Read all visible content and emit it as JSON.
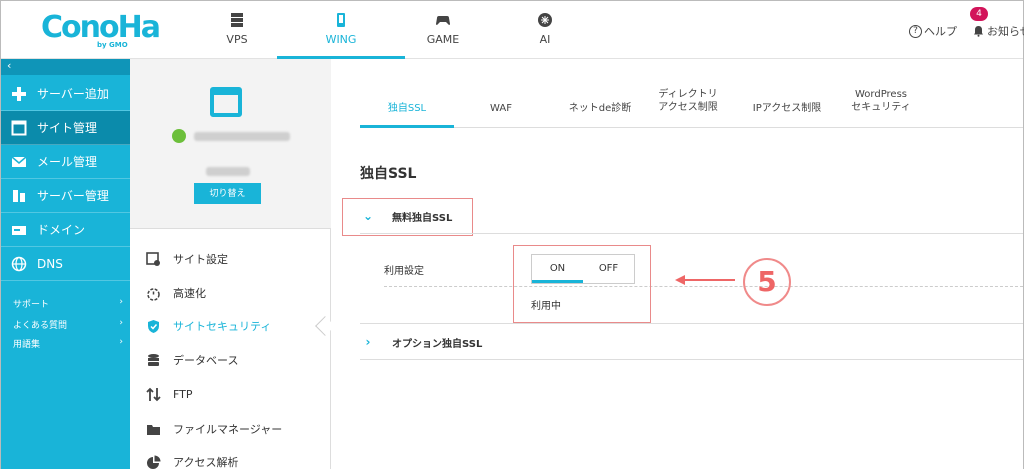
{
  "brand": {
    "name": "ConoHa",
    "sub": "by GMO"
  },
  "service_tabs": [
    {
      "label": "VPS",
      "icon": "server-icon",
      "active": false
    },
    {
      "label": "WING",
      "icon": "phone-icon",
      "active": true
    },
    {
      "label": "GAME",
      "icon": "gamepad-icon",
      "active": false
    },
    {
      "label": "AI",
      "icon": "ai-icon",
      "active": false
    }
  ],
  "header_right": {
    "help": "ヘルプ",
    "notice": "お知らせ",
    "notice_count": "4"
  },
  "sidebar": {
    "collapse": "‹",
    "items": [
      {
        "label": "サーバー追加",
        "icon": "plus-icon",
        "active": false
      },
      {
        "label": "サイト管理",
        "icon": "window-icon",
        "active": true
      },
      {
        "label": "メール管理",
        "icon": "mail-icon",
        "active": false
      },
      {
        "label": "サーバー管理",
        "icon": "server-manage-icon",
        "active": false
      },
      {
        "label": "ドメイン",
        "icon": "domain-icon",
        "active": false
      },
      {
        "label": "DNS",
        "icon": "globe-icon",
        "active": false
      }
    ],
    "sub_links": [
      {
        "label": "サポート",
        "arrow": "›"
      },
      {
        "label": "よくある質問",
        "arrow": "›"
      },
      {
        "label": "用語集",
        "arrow": "›"
      }
    ]
  },
  "server_panel": {
    "switch_label": "切り替え"
  },
  "site_menu": [
    {
      "label": "サイト設定",
      "icon": "site-settings-icon",
      "active": false
    },
    {
      "label": "高速化",
      "icon": "stopwatch-icon",
      "active": false
    },
    {
      "label": "サイトセキュリティ",
      "icon": "shield-icon",
      "active": true
    },
    {
      "label": "データベース",
      "icon": "database-icon",
      "active": false
    },
    {
      "label": "FTP",
      "icon": "transfer-icon",
      "active": false
    },
    {
      "label": "ファイルマネージャー",
      "icon": "folder-icon",
      "active": false
    },
    {
      "label": "アクセス解析",
      "icon": "pie-chart-icon",
      "active": false
    }
  ],
  "security_tabs": [
    {
      "line1": "独自SSL",
      "line2": "",
      "active": true
    },
    {
      "line1": "WAF",
      "line2": "",
      "active": false
    },
    {
      "line1": "ネットde診断",
      "line2": "",
      "active": false
    },
    {
      "line1": "ディレクトリ",
      "line2": "アクセス制限",
      "active": false
    },
    {
      "line1": "IPアクセス制限",
      "line2": "",
      "active": false
    },
    {
      "line1": "WordPress",
      "line2": "セキュリティ",
      "active": false
    }
  ],
  "content": {
    "title": "独自SSL",
    "free_ssl": {
      "label": "無料独自SSL",
      "expanded": true
    },
    "setting_label": "利用設定",
    "toggle": {
      "on": "ON",
      "off": "OFF",
      "selected": "ON"
    },
    "status": "利用中",
    "option_ssl": {
      "label": "オプション独自SSL",
      "expanded": false
    },
    "step_marker": "5"
  }
}
